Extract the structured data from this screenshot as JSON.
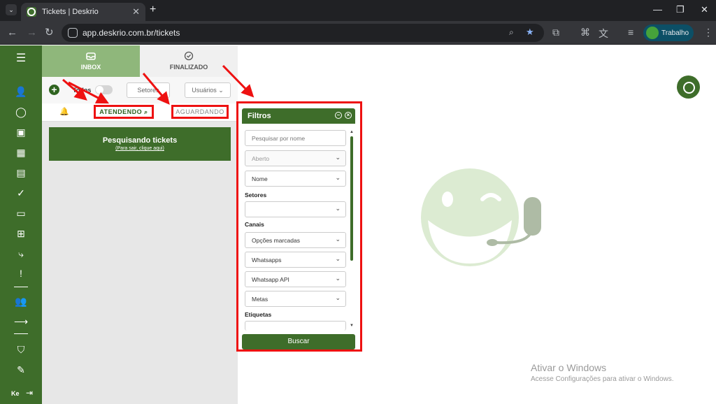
{
  "browser": {
    "tab_title": "Tickets | Deskrio",
    "url": "app.deskrio.com.br/tickets",
    "profile_label": "Trabalho"
  },
  "tabs": {
    "inbox": "INBOX",
    "finalizado": "FINALIZADO"
  },
  "filter_bar": {
    "todos_label": "Todos",
    "setores": "Setores",
    "usuarios": "Usuários"
  },
  "subtabs": {
    "atendendo": "ATENDENDO",
    "aguardando": "AGUARDANDO"
  },
  "search_banner": {
    "title": "Pesquisando tickets",
    "subtitle": "(Para sair, clique aqui)"
  },
  "filtros": {
    "title": "Filtros",
    "search_placeholder": "Pesquisar por nome",
    "status_value": "Aberto",
    "order_value": "Nome",
    "setores_label": "Setores",
    "canais_label": "Canais",
    "canais_value": "Opções marcadas",
    "whatsapps": "Whatsapps",
    "whatsapp_api": "Whatsapp API",
    "metas": "Metas",
    "etiquetas_label": "Etiquetas",
    "buscar": "Buscar"
  },
  "sidebar": {
    "user_initials": "Ke"
  },
  "watermark": {
    "line1": "Ativar o Windows",
    "line2": "Acesse Configurações para ativar o Windows."
  },
  "colors": {
    "brand_green": "#3e6d2a",
    "inbox_tab_green": "#8fb77b",
    "annotation_red": "#e11111"
  }
}
